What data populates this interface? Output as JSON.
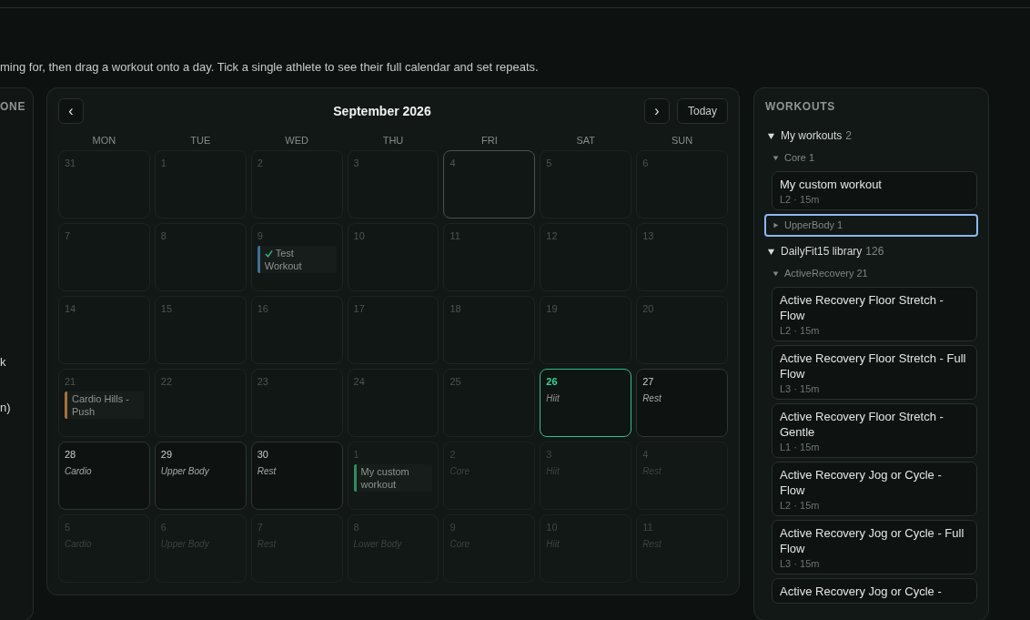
{
  "intro": "ming for, then drag a workout onto a day. Tick a single athlete to see their full calendar and set repeats.",
  "left_panel": {
    "heading": "ONE",
    "texts": [
      "k",
      "n)"
    ]
  },
  "calendar": {
    "title": "September 2026",
    "prev": "‹",
    "next": "›",
    "today_button": "Today",
    "weekdays": [
      "MON",
      "TUE",
      "WED",
      "THU",
      "FRI",
      "SAT",
      "SUN"
    ],
    "days": [
      {
        "number": "31",
        "kind": "plain"
      },
      {
        "number": "1",
        "kind": "plain"
      },
      {
        "number": "2",
        "kind": "plain"
      },
      {
        "number": "3",
        "kind": "plain"
      },
      {
        "number": "4",
        "kind": "hover"
      },
      {
        "number": "5",
        "kind": "plain"
      },
      {
        "number": "6",
        "kind": "plain"
      },
      {
        "number": "7",
        "kind": "plain"
      },
      {
        "number": "8",
        "kind": "plain"
      },
      {
        "number": "9",
        "kind": "plain",
        "events": [
          {
            "title": "Test Workout",
            "color": "#3f6f95",
            "done": true
          }
        ]
      },
      {
        "number": "10",
        "kind": "plain"
      },
      {
        "number": "11",
        "kind": "plain"
      },
      {
        "number": "12",
        "kind": "plain"
      },
      {
        "number": "13",
        "kind": "plain"
      },
      {
        "number": "14",
        "kind": "plain"
      },
      {
        "number": "15",
        "kind": "plain"
      },
      {
        "number": "16",
        "kind": "plain"
      },
      {
        "number": "17",
        "kind": "plain"
      },
      {
        "number": "18",
        "kind": "plain"
      },
      {
        "number": "19",
        "kind": "plain"
      },
      {
        "number": "20",
        "kind": "plain"
      },
      {
        "number": "21",
        "kind": "plain",
        "events": [
          {
            "title": "Cardio Hills - Push",
            "color": "#a8703a",
            "done": false
          }
        ]
      },
      {
        "number": "22",
        "kind": "plain"
      },
      {
        "number": "23",
        "kind": "plain"
      },
      {
        "number": "24",
        "kind": "plain"
      },
      {
        "number": "25",
        "kind": "plain"
      },
      {
        "number": "26",
        "kind": "today",
        "plan": "Hiit"
      },
      {
        "number": "27",
        "kind": "active",
        "plan": "Rest"
      },
      {
        "number": "28",
        "kind": "active",
        "plan": "Cardio"
      },
      {
        "number": "29",
        "kind": "active",
        "plan": "Upper Body"
      },
      {
        "number": "30",
        "kind": "active",
        "plan": "Rest"
      },
      {
        "number": "1",
        "kind": "muted",
        "events": [
          {
            "title": "My custom workout",
            "color": "#2f8a62",
            "done": false
          }
        ]
      },
      {
        "number": "2",
        "kind": "muted",
        "plan": "Core"
      },
      {
        "number": "3",
        "kind": "muted",
        "plan": "Hiit"
      },
      {
        "number": "4",
        "kind": "muted",
        "plan": "Rest"
      },
      {
        "number": "5",
        "kind": "muted",
        "plan": "Cardio"
      },
      {
        "number": "6",
        "kind": "muted",
        "plan": "Upper Body"
      },
      {
        "number": "7",
        "kind": "muted",
        "plan": "Rest"
      },
      {
        "number": "8",
        "kind": "muted",
        "plan": "Lower Body"
      },
      {
        "number": "9",
        "kind": "muted",
        "plan": "Core"
      },
      {
        "number": "10",
        "kind": "muted",
        "plan": "Hiit"
      },
      {
        "number": "11",
        "kind": "muted",
        "plan": "Rest"
      }
    ]
  },
  "workouts": {
    "title": "WORKOUTS",
    "groups": [
      {
        "label": "My workouts",
        "count": "2",
        "expanded": true,
        "children": [
          {
            "label": "Core",
            "count": "1",
            "expanded": true,
            "focused": false,
            "items": [
              {
                "title": "My custom workout",
                "meta": "L2 · 15m"
              }
            ]
          },
          {
            "label": "UpperBody",
            "count": "1",
            "expanded": false,
            "focused": true
          }
        ]
      },
      {
        "label": "DailyFit15 library",
        "count": "126",
        "expanded": true,
        "children": [
          {
            "label": "ActiveRecovery",
            "count": "21",
            "expanded": true,
            "focused": false,
            "items": [
              {
                "title": "Active Recovery Floor Stretch - Flow",
                "meta": "L2 · 15m"
              },
              {
                "title": "Active Recovery Floor Stretch - Full Flow",
                "meta": "L3 · 15m"
              },
              {
                "title": "Active Recovery Floor Stretch - Gentle",
                "meta": "L1 · 15m"
              },
              {
                "title": "Active Recovery Jog or Cycle - Flow",
                "meta": "L2 · 15m"
              },
              {
                "title": "Active Recovery Jog or Cycle - Full Flow",
                "meta": "L3 · 15m"
              },
              {
                "title": "Active Recovery Jog or Cycle -"
              }
            ]
          }
        ]
      }
    ]
  }
}
